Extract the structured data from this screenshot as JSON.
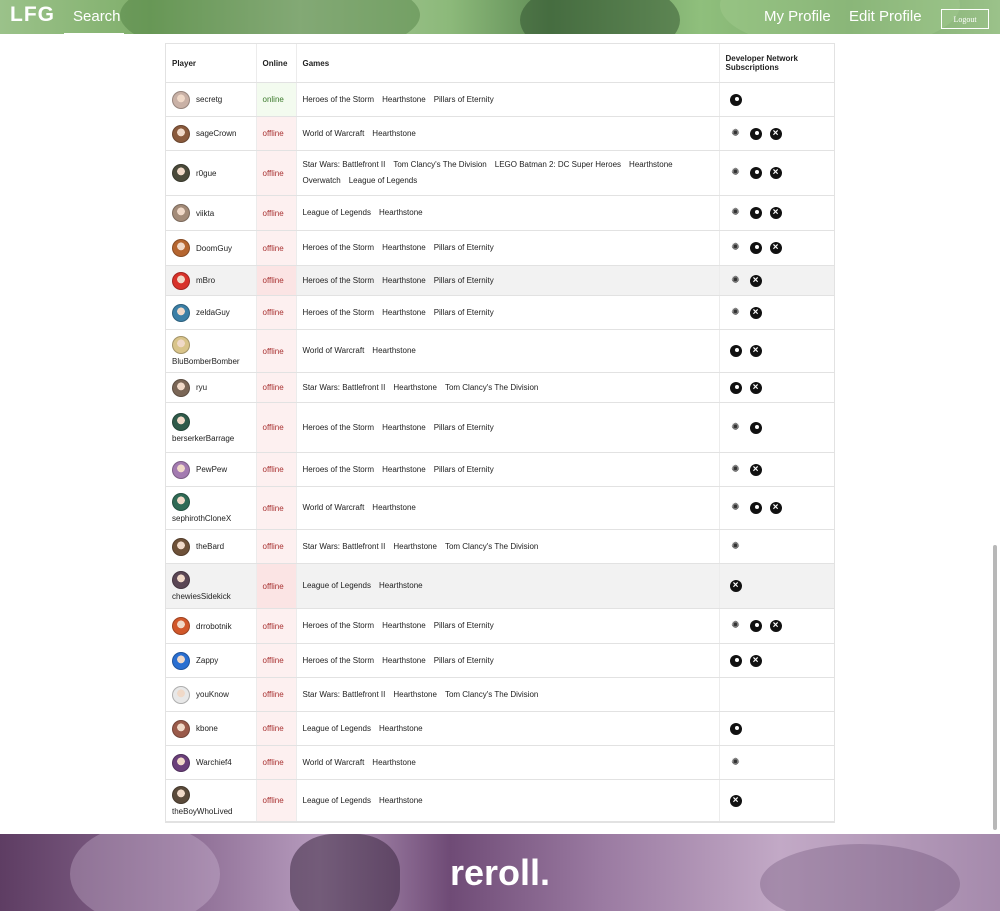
{
  "nav": {
    "logo": "LFG",
    "search": "Search",
    "my_profile": "My Profile",
    "edit_profile": "Edit Profile",
    "logout": "Logout"
  },
  "table": {
    "headers": {
      "player": "Player",
      "online": "Online",
      "games": "Games",
      "subscriptions": "Developer Network Subscriptions"
    },
    "rows": [
      {
        "name": "secretg",
        "status": "online",
        "games": [
          "Heroes of the Storm",
          "Hearthstone",
          "Pillars of Eternity"
        ],
        "subs": [
          "steam"
        ],
        "avatar_color": "#c9b1a6"
      },
      {
        "name": "sageCrown",
        "status": "offline",
        "games": [
          "World of Warcraft",
          "Hearthstone"
        ],
        "subs": [
          "battlenet",
          "steam",
          "xbox"
        ],
        "avatar_color": "#8a5a3c"
      },
      {
        "name": "r0gue",
        "status": "offline",
        "games": [
          "Star Wars: Battlefront II",
          "Tom Clancy's The Division",
          "LEGO Batman 2: DC Super Heroes",
          "Hearthstone",
          "Overwatch",
          "League of Legends"
        ],
        "subs": [
          "battlenet",
          "steam",
          "xbox"
        ],
        "avatar_color": "#4a4a3a"
      },
      {
        "name": "viikta",
        "status": "offline",
        "games": [
          "League of Legends",
          "Hearthstone"
        ],
        "subs": [
          "battlenet",
          "steam",
          "xbox"
        ],
        "avatar_color": "#a38b78"
      },
      {
        "name": "DoomGuy",
        "status": "offline",
        "games": [
          "Heroes of the Storm",
          "Hearthstone",
          "Pillars of Eternity"
        ],
        "subs": [
          "battlenet",
          "steam",
          "xbox"
        ],
        "avatar_color": "#b5652f"
      },
      {
        "name": "mBro",
        "status": "offline",
        "games": [
          "Heroes of the Storm",
          "Hearthstone",
          "Pillars of Eternity"
        ],
        "subs": [
          "battlenet",
          "xbox"
        ],
        "avatar_color": "#d8322a"
      },
      {
        "name": "zeldaGuy",
        "status": "offline",
        "games": [
          "Heroes of the Storm",
          "Hearthstone",
          "Pillars of Eternity"
        ],
        "subs": [
          "battlenet",
          "xbox"
        ],
        "avatar_color": "#3b7fa6"
      },
      {
        "name": "BluBomberBomber",
        "status": "offline",
        "games": [
          "World of Warcraft",
          "Hearthstone"
        ],
        "subs": [
          "steam",
          "xbox"
        ],
        "avatar_color": "#d9c48a"
      },
      {
        "name": "ryu",
        "status": "offline",
        "games": [
          "Star Wars: Battlefront II",
          "Hearthstone",
          "Tom Clancy's The Division"
        ],
        "subs": [
          "steam",
          "xbox"
        ],
        "avatar_color": "#7a6656"
      },
      {
        "name": "berserkerBarrage",
        "status": "offline",
        "games": [
          "Heroes of the Storm",
          "Hearthstone",
          "Pillars of Eternity"
        ],
        "subs": [
          "battlenet",
          "steam"
        ],
        "avatar_color": "#2f5a4a"
      },
      {
        "name": "PewPew",
        "status": "offline",
        "games": [
          "Heroes of the Storm",
          "Hearthstone",
          "Pillars of Eternity"
        ],
        "subs": [
          "battlenet",
          "xbox"
        ],
        "avatar_color": "#a37ab0"
      },
      {
        "name": "sephirothCloneX",
        "status": "offline",
        "games": [
          "World of Warcraft",
          "Hearthstone"
        ],
        "subs": [
          "battlenet",
          "steam",
          "xbox"
        ],
        "avatar_color": "#2f6a55"
      },
      {
        "name": "theBard",
        "status": "offline",
        "games": [
          "Star Wars: Battlefront II",
          "Hearthstone",
          "Tom Clancy's The Division"
        ],
        "subs": [
          "battlenet"
        ],
        "avatar_color": "#6e5138"
      },
      {
        "name": "chewiesSidekick",
        "status": "offline",
        "games": [
          "League of Legends",
          "Hearthstone"
        ],
        "subs": [
          "xbox"
        ],
        "avatar_color": "#5a4654"
      },
      {
        "name": "drrobotnik",
        "status": "offline",
        "games": [
          "Heroes of the Storm",
          "Hearthstone",
          "Pillars of Eternity"
        ],
        "subs": [
          "battlenet",
          "steam",
          "xbox"
        ],
        "avatar_color": "#d1572a"
      },
      {
        "name": "Zappy",
        "status": "offline",
        "games": [
          "Heroes of the Storm",
          "Hearthstone",
          "Pillars of Eternity"
        ],
        "subs": [
          "steam",
          "xbox"
        ],
        "avatar_color": "#2a6fd1"
      },
      {
        "name": "youKnow",
        "status": "offline",
        "games": [
          "Star Wars: Battlefront II",
          "Hearthstone",
          "Tom Clancy's The Division"
        ],
        "subs": [],
        "avatar_color": "#e8e8e8"
      },
      {
        "name": "kbone",
        "status": "offline",
        "games": [
          "League of Legends",
          "Hearthstone"
        ],
        "subs": [
          "steam"
        ],
        "avatar_color": "#9a5a4a"
      },
      {
        "name": "Warchief4",
        "status": "offline",
        "games": [
          "World of Warcraft",
          "Hearthstone"
        ],
        "subs": [
          "battlenet"
        ],
        "avatar_color": "#6a3f7a"
      },
      {
        "name": "theBoyWhoLived",
        "status": "offline",
        "games": [
          "League of Legends",
          "Hearthstone"
        ],
        "subs": [
          "xbox"
        ],
        "avatar_color": "#5a4a3a"
      }
    ]
  },
  "footer": {
    "brand": "reroll."
  }
}
